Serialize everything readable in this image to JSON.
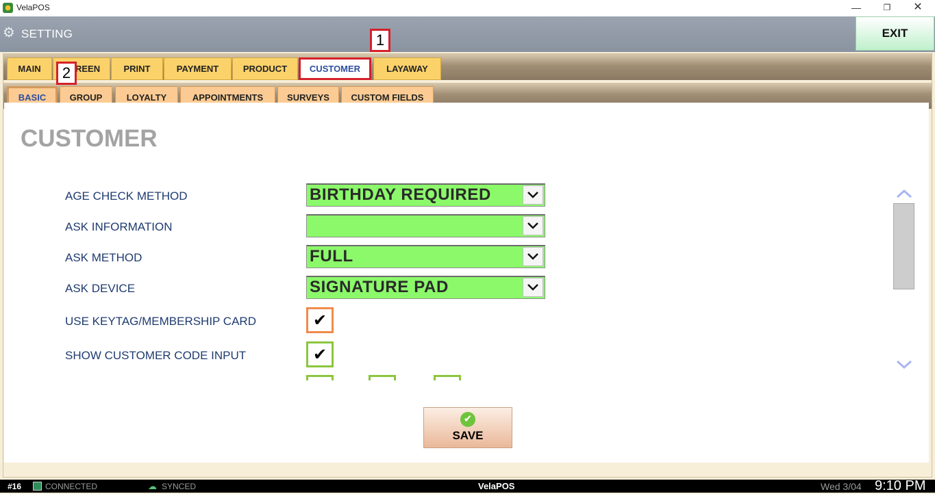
{
  "window": {
    "title": "VelaPOS",
    "minimize": "—",
    "maximize": "❐",
    "close": "✕"
  },
  "header": {
    "title": "SETTING",
    "exit_label": "EXIT"
  },
  "main_tabs": [
    {
      "label": "MAIN"
    },
    {
      "label": "SCREEN"
    },
    {
      "label": "PRINT"
    },
    {
      "label": "PAYMENT"
    },
    {
      "label": "PRODUCT"
    },
    {
      "label": "CUSTOMER",
      "active": true
    },
    {
      "label": "LAYAWAY"
    }
  ],
  "sub_tabs": [
    {
      "label": "BASIC",
      "active": true
    },
    {
      "label": "GROUP"
    },
    {
      "label": "LOYALTY"
    },
    {
      "label": "APPOINTMENTS"
    },
    {
      "label": "SURVEYS"
    },
    {
      "label": "CUSTOM FIELDS"
    }
  ],
  "annotations": {
    "tag1": "1",
    "tag2": "2"
  },
  "section": {
    "title": "CUSTOMER"
  },
  "fields": [
    {
      "label": "AGE CHECK METHOD",
      "value": "BIRTHDAY REQUIRED"
    },
    {
      "label": "ASK INFORMATION",
      "value": ""
    },
    {
      "label": "ASK METHOD",
      "value": "FULL"
    },
    {
      "label": "ASK DEVICE",
      "value": "SIGNATURE PAD"
    }
  ],
  "checkboxes": [
    {
      "label": "USE KEYTAG/MEMBERSHIP CARD",
      "checked": true,
      "mark": "✔"
    },
    {
      "label": "SHOW CUSTOMER CODE INPUT",
      "checked": true,
      "mark": "✔"
    }
  ],
  "save": {
    "label": "SAVE"
  },
  "status": {
    "terminal": "#16",
    "connection": "CONNECTED",
    "sync": "SYNCED",
    "brand": "VelaPOS",
    "date": "Wed 3/04",
    "time": "9:10 PM"
  },
  "colors": {
    "select_bg": "#8bf96a",
    "highlight": "#d6202a",
    "tab_main": "#fbd26a",
    "tab_sub": "#fccb93"
  }
}
